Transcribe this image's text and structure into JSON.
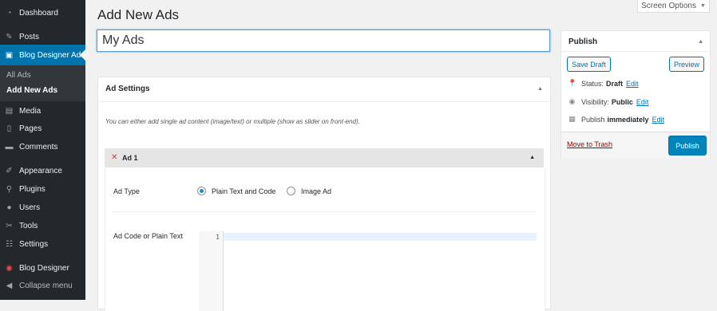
{
  "sidebar": {
    "menu": [
      {
        "label": "Dashboard",
        "icon": "dashboard-icon"
      },
      {
        "label": "Posts",
        "icon": "pin-icon"
      },
      {
        "label": "Blog Designer Ads",
        "icon": "ads-icon"
      },
      {
        "label": "Media",
        "icon": "media-icon"
      },
      {
        "label": "Pages",
        "icon": "pages-icon"
      },
      {
        "label": "Comments",
        "icon": "comments-icon"
      },
      {
        "label": "Appearance",
        "icon": "appearance-icon"
      },
      {
        "label": "Plugins",
        "icon": "plugins-icon"
      },
      {
        "label": "Users",
        "icon": "users-icon"
      },
      {
        "label": "Tools",
        "icon": "tools-icon"
      },
      {
        "label": "Settings",
        "icon": "settings-icon"
      },
      {
        "label": "Blog Designer",
        "icon": "blog-designer-icon"
      },
      {
        "label": "Collapse menu",
        "icon": "collapse-icon"
      }
    ],
    "submenu": [
      {
        "label": "All Ads"
      },
      {
        "label": "Add New Ads"
      }
    ]
  },
  "screen_options": {
    "label": "Screen Options"
  },
  "page": {
    "title": "Add New Ads",
    "post_title_value": "My Ads"
  },
  "ad_settings": {
    "title": "Ad Settings",
    "help": "You can either add single ad content (image/text) or multiple (show as slider on front-end).",
    "ad1": {
      "title": "Ad 1",
      "ad_type_label": "Ad Type",
      "options": [
        "Plain Text and Code",
        "Image Ad"
      ],
      "selected": "Plain Text and Code",
      "code_label": "Ad Code or Plain Text",
      "line_number": "1"
    }
  },
  "publish": {
    "title": "Publish",
    "save_draft": "Save Draft",
    "preview": "Preview",
    "status_label": "Status:",
    "status_value": "Draft",
    "visibility_label": "Visibility:",
    "visibility_value": "Public",
    "publish_label": "Publish",
    "publish_value": "immediately",
    "edit": "Edit",
    "trash": "Move to Trash",
    "publish_button": "Publish"
  },
  "colors": {
    "accent": "#0073aa",
    "sidebar_bg": "#23282d",
    "active_menu": "#0073aa",
    "trash": "#a00"
  }
}
